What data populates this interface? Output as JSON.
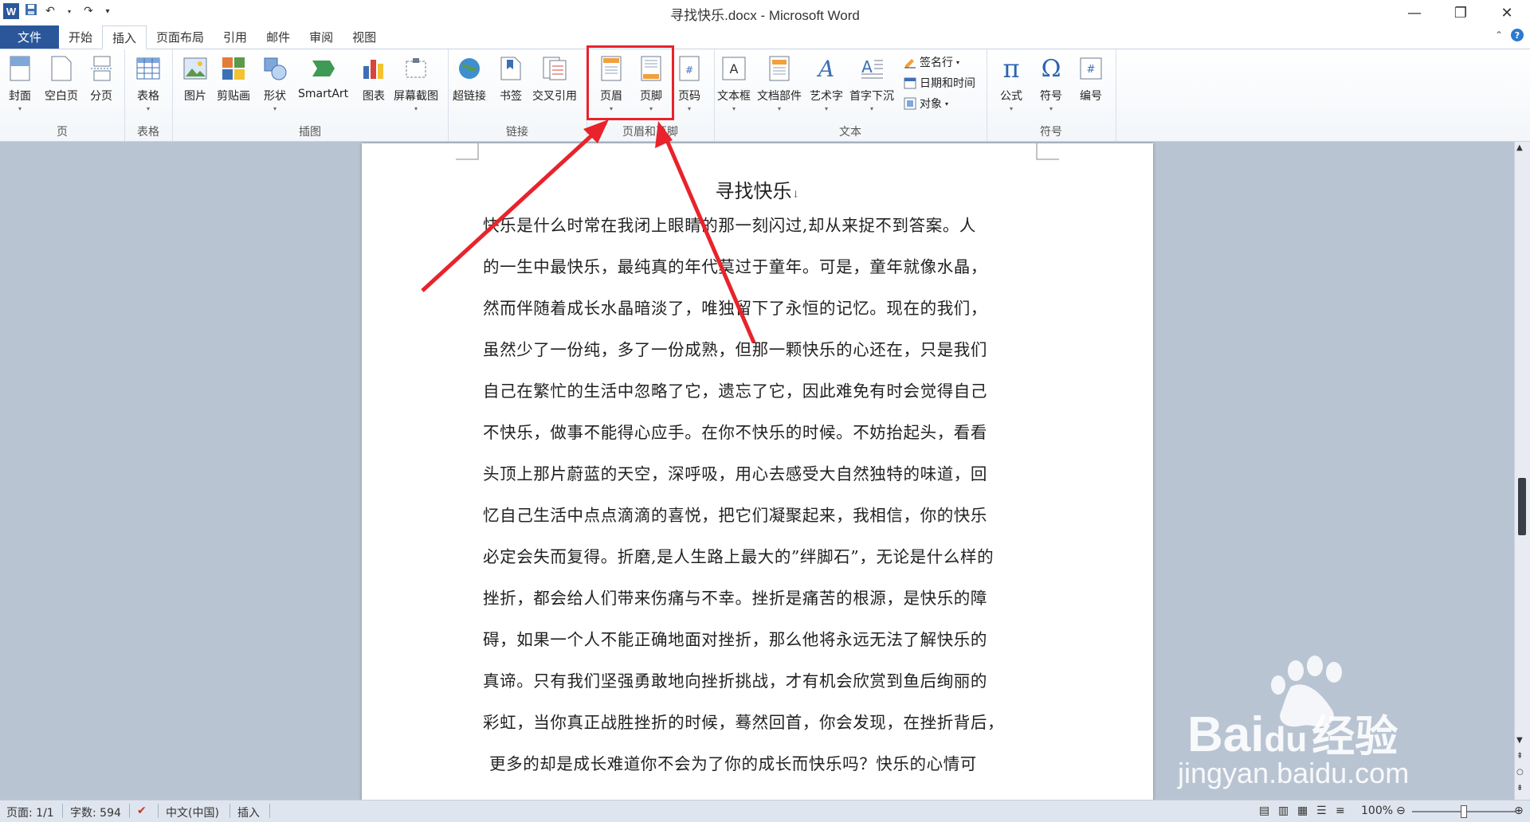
{
  "window": {
    "title": "寻找快乐.docx - Microsoft Word",
    "app_icon": "W"
  },
  "tabs": [
    {
      "label": "文件"
    },
    {
      "label": "开始"
    },
    {
      "label": "插入"
    },
    {
      "label": "页面布局"
    },
    {
      "label": "引用"
    },
    {
      "label": "邮件"
    },
    {
      "label": "审阅"
    },
    {
      "label": "视图"
    }
  ],
  "active_tab": "插入",
  "ribbon": {
    "groups": {
      "pages": "页",
      "tables": "表格",
      "illustrations": "插图",
      "links": "链接",
      "header_footer": "页眉和页脚",
      "text": "文本",
      "symbols": "符号"
    },
    "buttons": {
      "cover": "封面",
      "blank": "空白页",
      "pagebreak": "分页",
      "table": "表格",
      "picture": "图片",
      "clipart": "剪贴画",
      "shapes": "形状",
      "smartart": "SmartArt",
      "chart": "图表",
      "screenshot": "屏幕截图",
      "hyperlink": "超链接",
      "bookmark": "书签",
      "crossref": "交叉引用",
      "header": "页眉",
      "footer": "页脚",
      "pagenum": "页码",
      "textbox": "文本框",
      "quickparts": "文档部件",
      "wordart": "艺术字",
      "dropcap": "首字下沉",
      "signature": "签名行",
      "datetime": "日期和时间",
      "object": "对象",
      "equation": "公式",
      "symbol": "符号",
      "number": "编号"
    }
  },
  "document": {
    "title": "寻找快乐",
    "lines": [
      "快乐是什么时常在我闭上眼睛的那一刻闪过,却从来捉不到答案。人",
      "的一生中最快乐，最纯真的年代莫过于童年。可是，童年就像水晶，",
      "然而伴随着成长水晶暗淡了，唯独留下了永恒的记忆。现在的我们，",
      "虽然少了一份纯，多了一份成熟，但那一颗快乐的心还在，只是我们",
      "自己在繁忙的生活中忽略了它，遗忘了它，因此难免有时会觉得自己",
      "不快乐，做事不能得心应手。在你不快乐的时候。不妨抬起头，看看",
      "头顶上那片蔚蓝的天空，深呼吸，用心去感受大自然独特的味道，回",
      "忆自己生活中点点滴滴的喜悦，把它们凝聚起来，我相信，你的快乐",
      "必定会失而复得。折磨,是人生路上最大的”绊脚石”，无论是什么样的",
      "挫折，都会给人们带来伤痛与不幸。挫折是痛苦的根源，是快乐的障",
      "碍，如果一个人不能正确地面对挫折，那么他将永远无法了解快乐的",
      "真谛。只有我们坚强勇敢地向挫折挑战，才有机会欣赏到鱼后绚丽的",
      "彩虹，当你真正战胜挫折的时候，蓦然回首，你会发现，在挫折背后，",
      "更多的却是成长难道你不会为了你的成长而快乐吗？快乐的心情可"
    ]
  },
  "status": {
    "page": "页面: 1/1",
    "words": "字数: 594",
    "language": "中文(中国)",
    "mode": "插入",
    "zoom": "100%"
  },
  "watermark": {
    "brand": "Bai",
    "brand2": "du",
    "brand_cn": "经验",
    "url": "jingyan.baidu.com"
  },
  "colors": {
    "file_tab": "#2b579a",
    "highlight": "#e8232b",
    "workspace": "#b9c4d3"
  }
}
